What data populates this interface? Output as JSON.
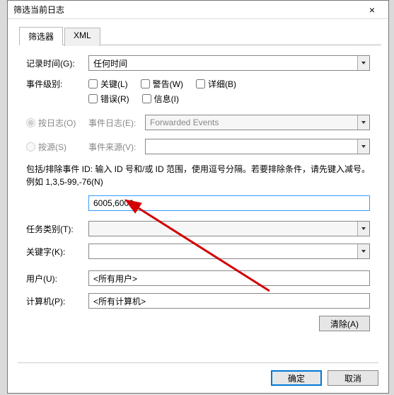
{
  "dialog": {
    "title": "筛选当前日志",
    "close": "×"
  },
  "tabs": {
    "filter": "筛选器",
    "xml": "XML"
  },
  "labels": {
    "logged": "记录时间(G):",
    "level": "事件级别:",
    "byLog": "按日志(O)",
    "bySource": "按源(S)",
    "eventLog": "事件日志(E):",
    "eventSource": "事件来源(V):",
    "helpText": "包括/排除事件 ID: 输入 ID 号和/或 ID 范围，使用逗号分隔。若要排除条件，请先键入减号。例如 1,3,5-99,-76(N)",
    "taskCategory": "任务类别(T):",
    "keywords": "关键字(K):",
    "user": "用户(U):",
    "computer": "计算机(P):"
  },
  "levels": {
    "critical": "关键(L)",
    "warning": "警告(W)",
    "verbose": "详细(B)",
    "error": "错误(R)",
    "information": "信息(I)"
  },
  "values": {
    "logged": "任何时间",
    "eventLog": "Forwarded Events",
    "eventIds": "6005,6006",
    "user": "<所有用户>",
    "computer": "<所有计算机>"
  },
  "buttons": {
    "clear": "清除(A)",
    "ok": "确定",
    "cancel": "取消"
  }
}
